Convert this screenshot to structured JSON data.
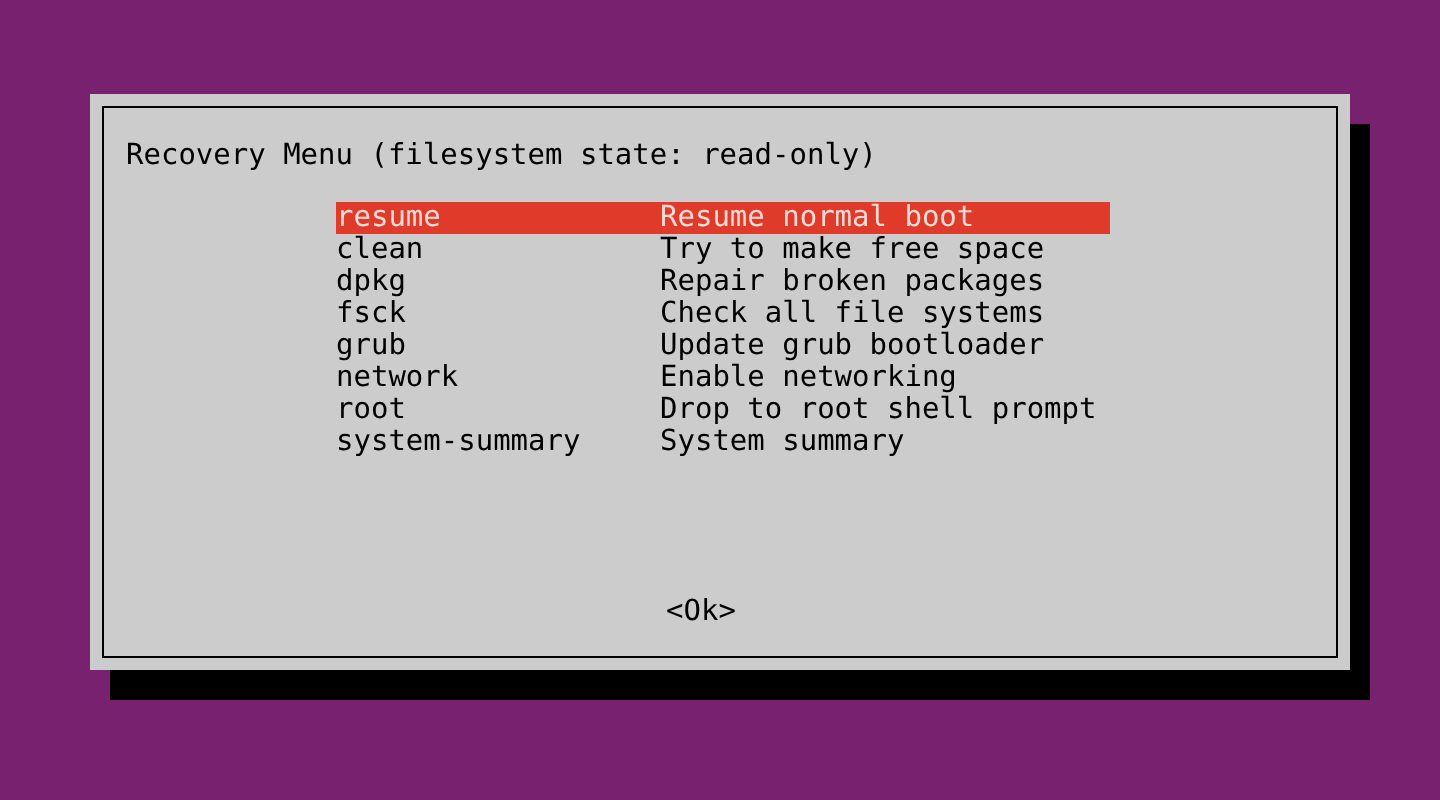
{
  "dialog": {
    "title": "Recovery Menu (filesystem state: read-only)",
    "items": [
      {
        "name": "resume",
        "description": "Resume normal boot",
        "selected": true
      },
      {
        "name": "clean",
        "description": "Try to make free space",
        "selected": false
      },
      {
        "name": "dpkg",
        "description": "Repair broken packages",
        "selected": false
      },
      {
        "name": "fsck",
        "description": "Check all file systems",
        "selected": false
      },
      {
        "name": "grub",
        "description": "Update grub bootloader",
        "selected": false
      },
      {
        "name": "network",
        "description": "Enable networking",
        "selected": false
      },
      {
        "name": "root",
        "description": "Drop to root shell prompt",
        "selected": false
      },
      {
        "name": "system-summary",
        "description": "System summary",
        "selected": false
      }
    ],
    "buttons": [
      "<Ok>"
    ]
  }
}
